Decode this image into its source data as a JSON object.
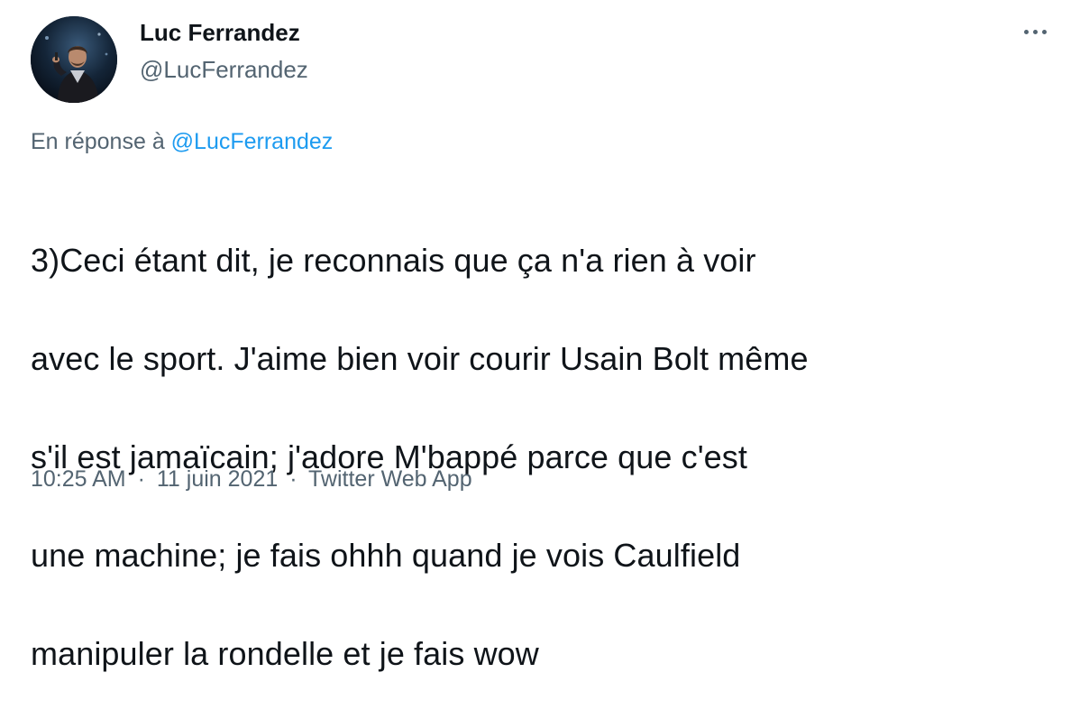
{
  "author": {
    "display_name": "Luc Ferrandez",
    "handle": "@LucFerrandez"
  },
  "more_menu": {
    "icon": "more-horizontal-icon"
  },
  "reply": {
    "prefix": "En réponse à",
    "mention": "@LucFerrandez"
  },
  "tweet": {
    "lines": [
      "3)Ceci étant dit, je  reconnais que ça n'a rien à voir",
      "avec le sport. J'aime bien voir courir Usain Bolt même",
      "s'il est jamaïcain; j'adore M'bappé parce que c'est",
      "une machine; je fais ohhh quand je vois Caulfield",
      "manipuler la rondelle et je fais wow"
    ]
  },
  "meta": {
    "time": "10:25 AM",
    "separator": "·",
    "date": "11 juin 2021",
    "source": "Twitter Web App"
  },
  "colors": {
    "text": "#0f1419",
    "secondary": "#536471",
    "link": "#1d9bf0"
  }
}
